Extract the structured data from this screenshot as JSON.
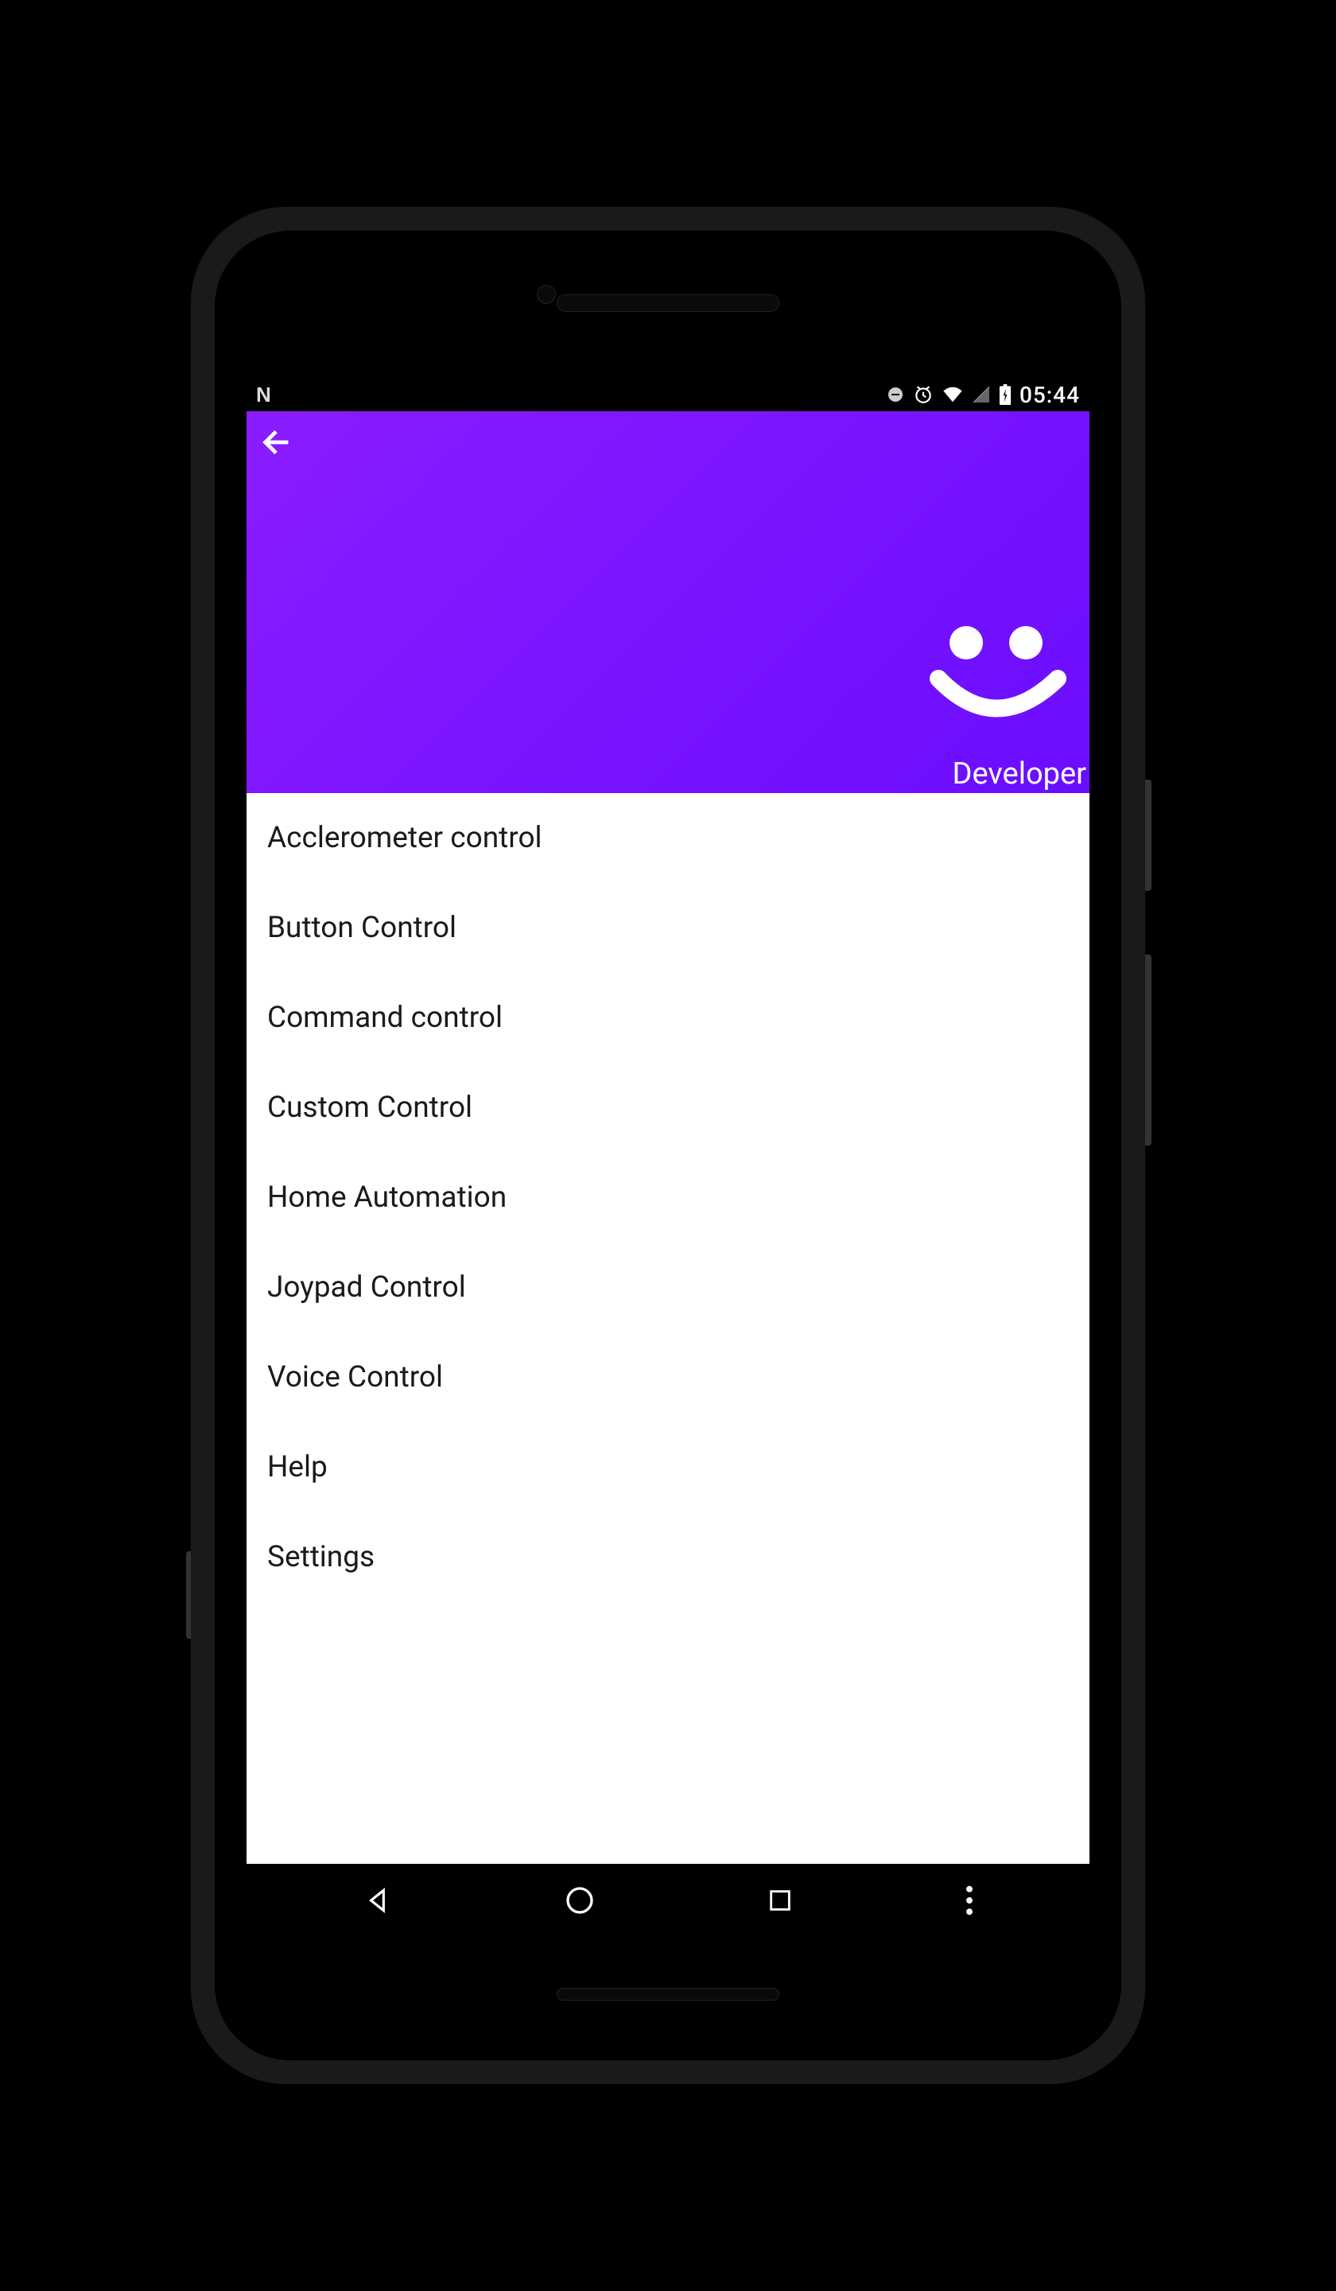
{
  "status_bar": {
    "time": "05:44"
  },
  "header": {
    "developer_label": "Developer"
  },
  "menu": {
    "items": [
      {
        "label": "Acclerometer control"
      },
      {
        "label": "Button Control"
      },
      {
        "label": "Command control"
      },
      {
        "label": "Custom Control"
      },
      {
        "label": "Home Automation"
      },
      {
        "label": "Joypad Control"
      },
      {
        "label": "Voice Control"
      },
      {
        "label": "Help"
      },
      {
        "label": "Settings"
      }
    ]
  }
}
